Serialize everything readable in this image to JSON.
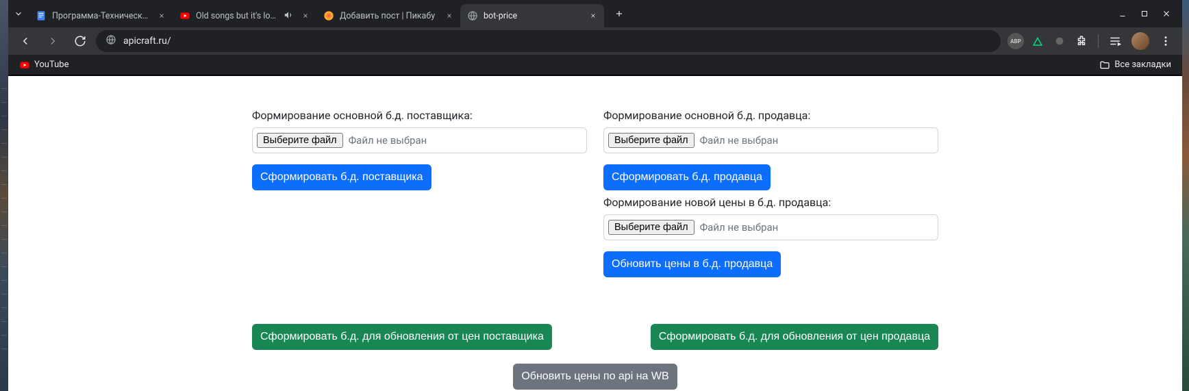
{
  "browser": {
    "tabs": [
      {
        "title": "Программа-Техническое з",
        "audio": false
      },
      {
        "title": "Old songs but it's lofi rer",
        "audio": true
      },
      {
        "title": "Добавить пост | Пикабу",
        "audio": false
      },
      {
        "title": "bot-price",
        "audio": false
      }
    ],
    "activeTabIndex": 3,
    "url": "apicraft.ru/",
    "bookmarks": {
      "youtube": "YouTube",
      "all": "Все закладки"
    }
  },
  "page": {
    "supplier": {
      "label": "Формирование основной б.д. поставщика:",
      "chooseFile": "Выберите файл",
      "noFile": "Файл не выбран",
      "submit": "Сформировать б.д. поставщика"
    },
    "seller": {
      "label": "Формирование основной б.д. продавца:",
      "chooseFile": "Выберите файл",
      "noFile": "Файл не выбран",
      "submit": "Сформировать б.д. продавца"
    },
    "newPrice": {
      "label": "Формирование новой цены в б.д. продавца:",
      "chooseFile": "Выберите файл",
      "noFile": "Файл не выбран",
      "submit": "Обновить цены в б.д. продавца"
    },
    "bottom": {
      "fromSupplier": "Сформировать б.д. для обновления от цен поставщика",
      "fromSeller": "Сформировать б.д. для обновления от цен продавца",
      "updateWB": "Обновить цены по api на WB"
    }
  }
}
